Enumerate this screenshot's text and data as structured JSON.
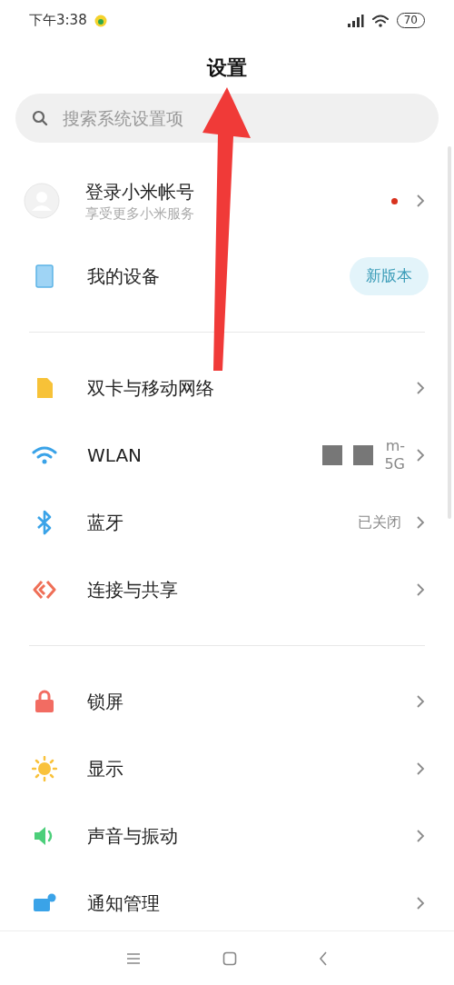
{
  "status_bar": {
    "time": "下午3:38",
    "battery": "70"
  },
  "title": "设置",
  "search": {
    "placeholder": "搜索系统设置项"
  },
  "account": {
    "title": "登录小米帐号",
    "subtitle": "享受更多小米服务",
    "notification_dot": true
  },
  "device": {
    "label": "我的设备",
    "badge": "新版本"
  },
  "sections": [
    {
      "items": [
        {
          "kind": "sim",
          "label": "双卡与移动网络"
        },
        {
          "kind": "wifi",
          "label": "WLAN",
          "value_lines": [
            "m-",
            "5G"
          ]
        },
        {
          "kind": "bluetooth",
          "label": "蓝牙",
          "value": "已关闭"
        },
        {
          "kind": "share",
          "label": "连接与共享"
        }
      ]
    },
    {
      "items": [
        {
          "kind": "lock",
          "label": "锁屏"
        },
        {
          "kind": "display",
          "label": "显示"
        },
        {
          "kind": "sound",
          "label": "声音与振动"
        },
        {
          "kind": "notification",
          "label": "通知管理"
        }
      ]
    }
  ]
}
